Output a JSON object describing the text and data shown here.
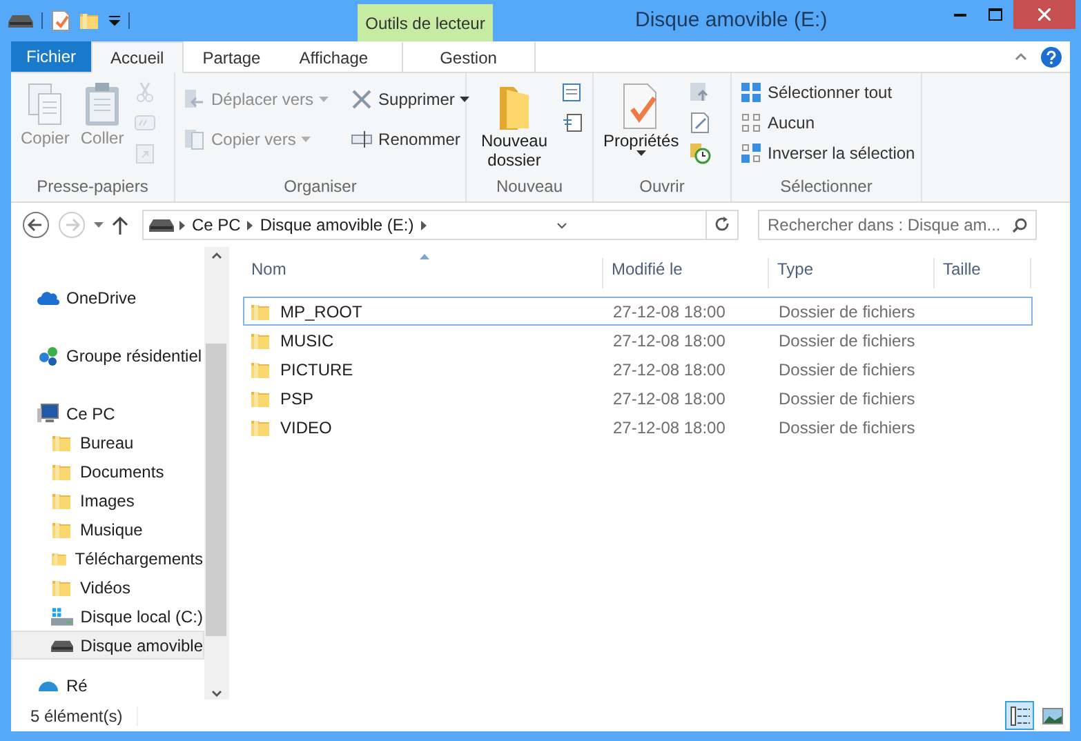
{
  "window": {
    "title": "Disque amovible (E:)"
  },
  "contextual_group": {
    "label": "Outils de lecteur"
  },
  "file_tab": {
    "label": "Fichier"
  },
  "tabs": [
    {
      "label": "Accueil",
      "kind": "normal",
      "selected": true
    },
    {
      "label": "Partage",
      "kind": "normal",
      "selected": false
    },
    {
      "label": "Affichage",
      "kind": "normal",
      "selected": false
    },
    {
      "label": "Gestion",
      "kind": "contextual",
      "selected": false
    }
  ],
  "ribbon": [
    {
      "label": "Presse-papiers",
      "commands": [
        {
          "kind": "large",
          "label": "Copier",
          "disabled": true
        },
        {
          "kind": "large",
          "label": "Coller",
          "disabled": true
        },
        {
          "kind": "iconstack",
          "disabled": true
        }
      ]
    },
    {
      "label": "Organiser",
      "commands": [
        {
          "kind": "smallstack",
          "items": [
            {
              "label": "Déplacer vers",
              "disabled": true,
              "dropdown": true
            },
            {
              "label": "Copier vers",
              "disabled": true,
              "dropdown": true
            }
          ]
        },
        {
          "kind": "smallstack",
          "items": [
            {
              "label": "Supprimer",
              "disabled": false,
              "dropdown": true
            },
            {
              "label": "Renommer",
              "disabled": false,
              "dropdown": false
            }
          ]
        }
      ]
    },
    {
      "label": "Nouveau",
      "commands": [
        {
          "kind": "large",
          "label": "Nouveau dossier",
          "disabled": false
        },
        {
          "kind": "iconstack",
          "disabled": false
        }
      ]
    },
    {
      "label": "Ouvrir",
      "commands": [
        {
          "kind": "large",
          "label": "Propriétés",
          "disabled": false,
          "dropdown": true
        },
        {
          "kind": "iconstack",
          "disabled": false
        }
      ]
    },
    {
      "label": "Sélectionner",
      "commands": [
        {
          "kind": "smallstack",
          "items": [
            {
              "label": "Sélectionner tout",
              "disabled": false,
              "dropdown": false
            },
            {
              "label": "Aucun",
              "disabled": false,
              "dropdown": false
            },
            {
              "label": "Inverser la sélection",
              "disabled": false,
              "dropdown": false
            }
          ]
        }
      ]
    }
  ],
  "address": {
    "segments": [
      "Ce PC",
      "Disque amovible (E:)"
    ]
  },
  "search": {
    "placeholder": "Rechercher dans : Disque am..."
  },
  "navigation": [
    {
      "label": "OneDrive",
      "selected": false
    },
    {
      "label": "Groupe résidentiel",
      "selected": false
    },
    {
      "label": "Ce PC",
      "selected": false,
      "children": [
        {
          "label": "Bureau",
          "selected": false
        },
        {
          "label": "Documents",
          "selected": false
        },
        {
          "label": "Images",
          "selected": false
        },
        {
          "label": "Musique",
          "selected": false
        },
        {
          "label": "Téléchargements",
          "selected": false
        },
        {
          "label": "Vidéos",
          "selected": false
        },
        {
          "label": "Disque local (C:)",
          "selected": false
        },
        {
          "label": "Disque amovible",
          "selected": true
        }
      ]
    },
    {
      "label": "Ré",
      "selected": false
    }
  ],
  "table": {
    "columns": [
      "Nom",
      "Modifié le",
      "Type",
      "Taille"
    ],
    "rows": [
      {
        "name": "MP_ROOT",
        "modified": "27-12-08 18:00",
        "type": "Dossier de fichiers",
        "focused": true
      },
      {
        "name": "MUSIC",
        "modified": "27-12-08 18:00",
        "type": "Dossier de fichiers",
        "focused": false
      },
      {
        "name": "PICTURE",
        "modified": "27-12-08 18:00",
        "type": "Dossier de fichiers",
        "focused": false
      },
      {
        "name": "PSP",
        "modified": "27-12-08 18:00",
        "type": "Dossier de fichiers",
        "focused": false
      },
      {
        "name": "VIDEO",
        "modified": "27-12-08 18:00",
        "type": "Dossier de fichiers",
        "focused": false
      }
    ]
  },
  "status_bar": {
    "text": "5 élément(s)",
    "views": [
      {
        "kind": "details",
        "selected": true
      },
      {
        "kind": "thumbs",
        "selected": false
      }
    ]
  }
}
